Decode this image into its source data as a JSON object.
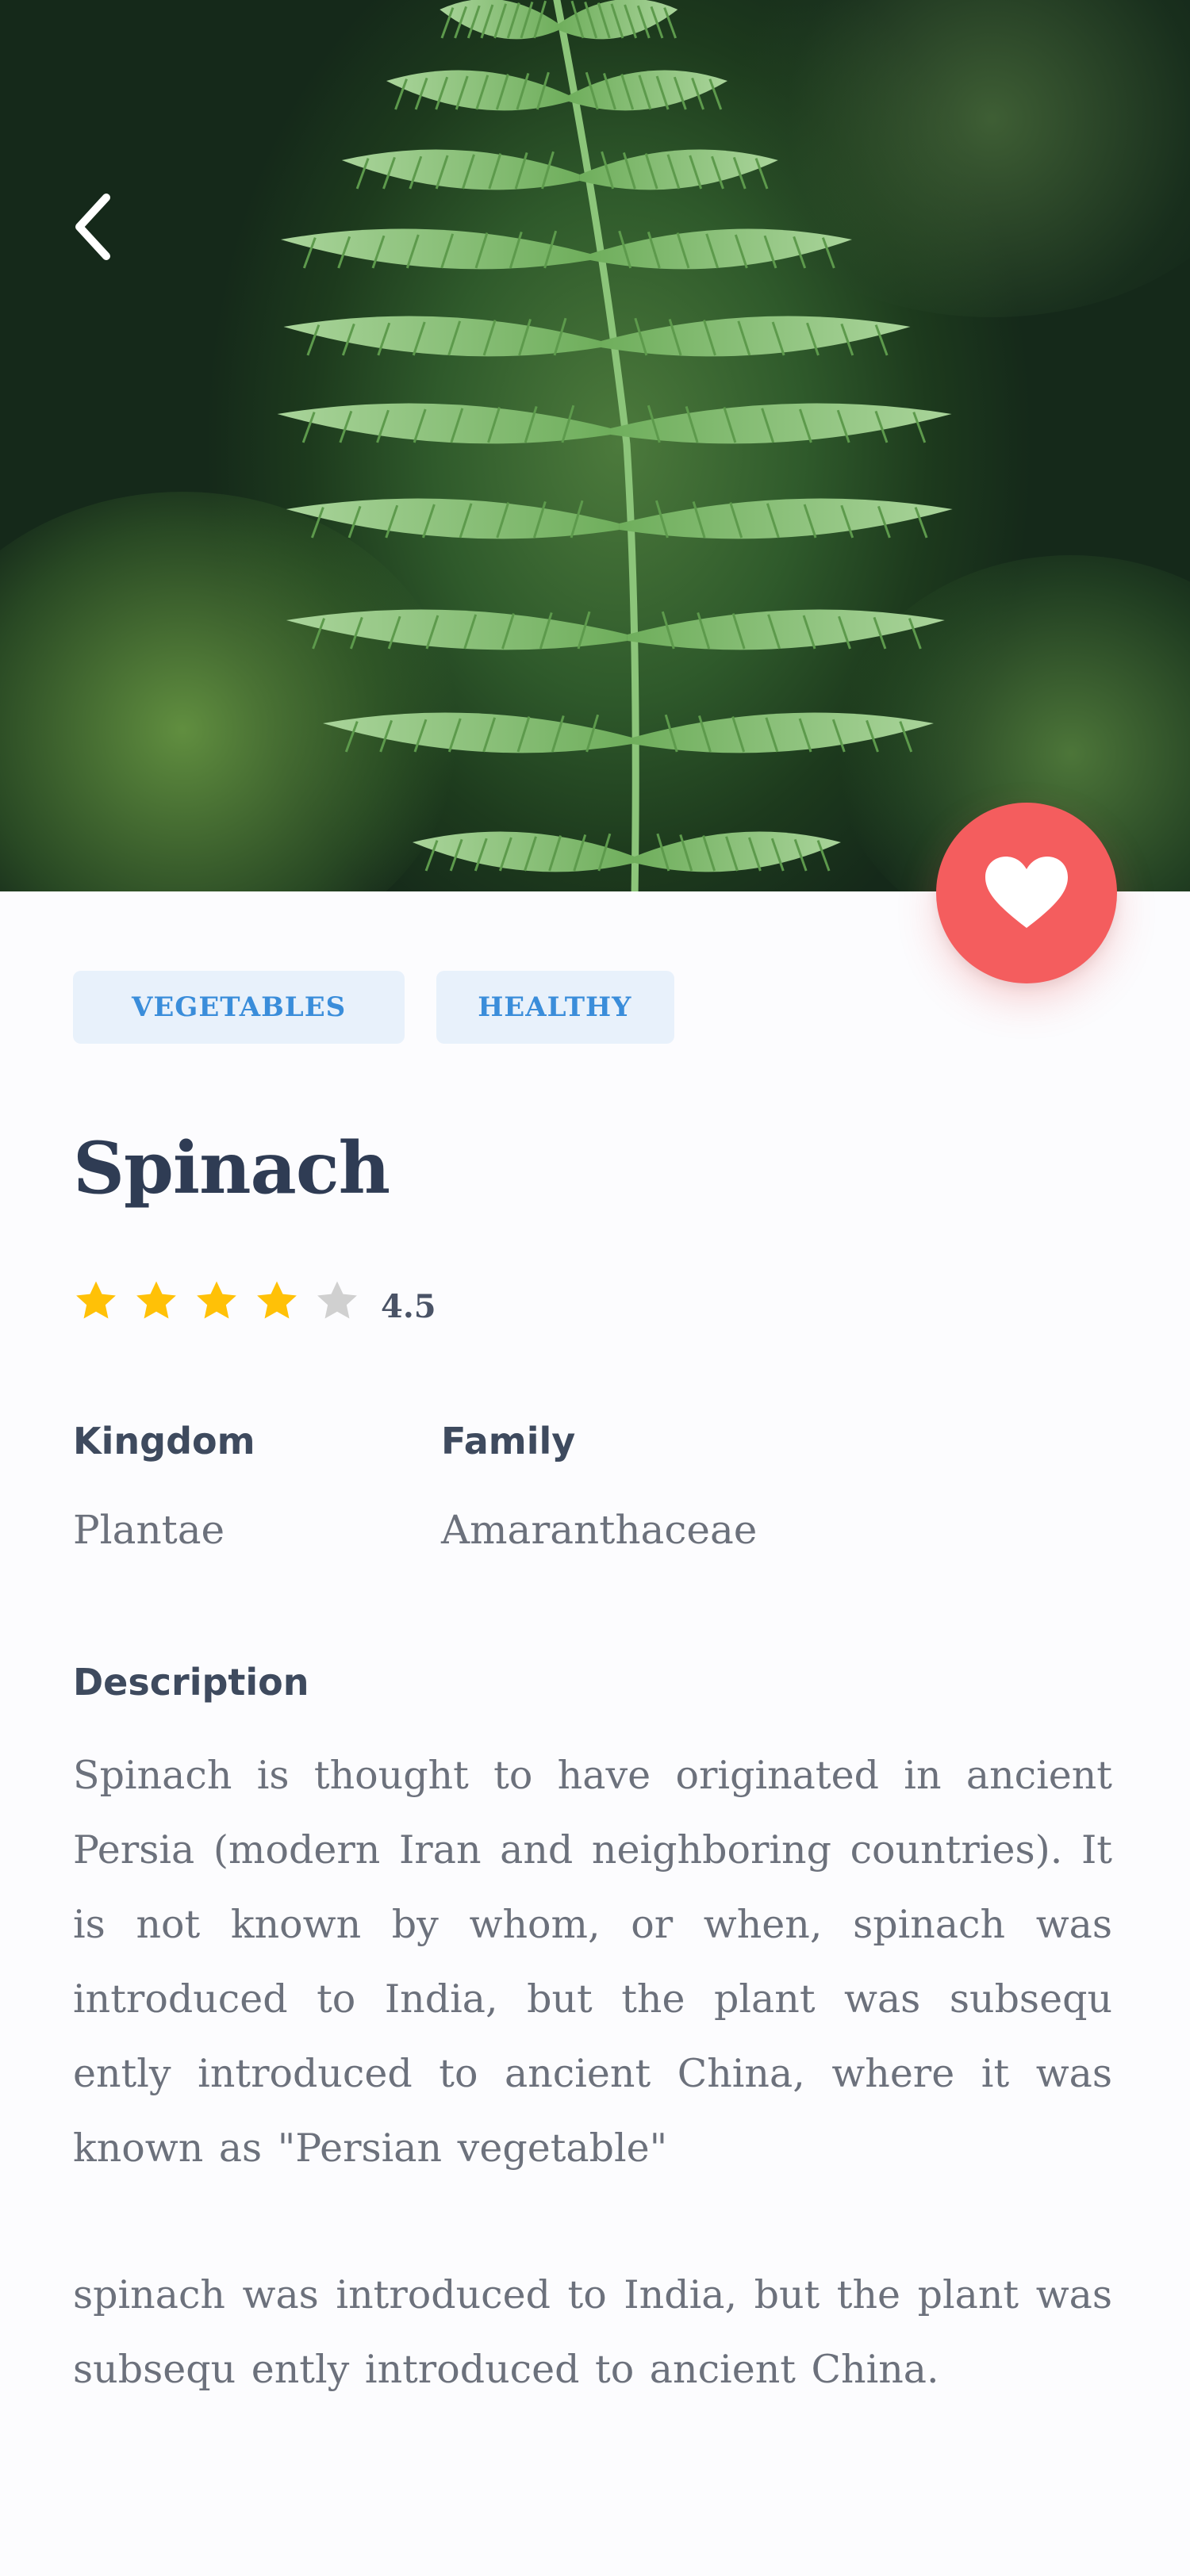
{
  "header": {
    "back_icon": "chevron-left-icon",
    "hero_image": "fern-frond-photo"
  },
  "favorite": {
    "icon": "heart-icon",
    "color": "#F45D5E"
  },
  "tags": [
    "VEGETABLES",
    "HEALTHY"
  ],
  "title": "Spinach",
  "rating": {
    "value": "4.5",
    "stars_filled": 4,
    "stars_total": 5,
    "star_color": "#FFC107",
    "empty_star_color": "#D0D0D0"
  },
  "info": {
    "kingdom_label": "Kingdom",
    "kingdom_value": "Plantae",
    "family_label": "Family",
    "family_value": "Amaranthaceae"
  },
  "description": {
    "label": "Description",
    "paragraph1": "Spinach is thought to have originated in ancient Persia (modern Iran and neighboring countries). It is not known by whom, or when, spinach was introduced to India, but the plant was subsequ ently introduced to ancient China, where it was known as \"Persian vegetable\"",
    "paragraph2": "spinach was introduced to India, but the plant was subsequ ently introduced to ancient China."
  },
  "colors": {
    "title": "#2F3C54",
    "tag_text": "#3A8DDA",
    "tag_bg": "#E8F1FB",
    "body_text": "#6C717C",
    "background": "#FCFCFE"
  }
}
